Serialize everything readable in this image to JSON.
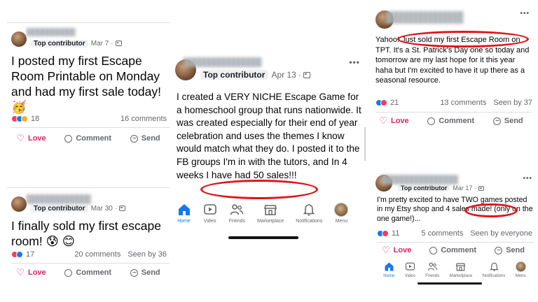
{
  "posts": [
    {
      "badge": "Top contributor",
      "date": "Mar 7",
      "text": "I posted my first Escape Room Printable on Monday and had my first sale today! 🥳",
      "reaction_count": "18",
      "comments": "16 comments",
      "actions": {
        "love": "Love",
        "comment": "Comment",
        "send": "Send"
      }
    },
    {
      "badge": "Top contributor",
      "date": "Mar 30",
      "text": "I finally sold my first escape room! 😰 😊",
      "reaction_count": "17",
      "comments": "20 comments",
      "seen": "Seen by 36",
      "actions": {
        "love": "Love",
        "comment": "Comment",
        "send": "Send"
      }
    },
    {
      "badge": "Top contributor",
      "date": "Apr 13",
      "text": "I created a VERY NICHE Escape Game for a homeschool group that runs nationwide. It was created especially for their end of year celebration and uses the themes I know would match what they do. I posted it to the FB groups I'm in with the tutors, and In 4 weeks I have had 50 sales!!!"
    },
    {
      "text": "Yahoo! Just sold my first Escape Room on TPT. It's a St. Patrick's Day one so today and tomorrow are my last hope for it this year haha but I'm excited to have it up there as a seasonal resource.",
      "reaction_count": "21",
      "comments": "13 comments",
      "seen": "Seen by 37",
      "actions": {
        "love": "Love",
        "comment": "Comment",
        "send": "Send"
      }
    },
    {
      "badge": "Top contributor",
      "date": "Mar 17",
      "text": "I'm pretty excited to have TWO games posted in my Etsy shop and 4 sales made! (only on the one game!)...",
      "reaction_count": "11",
      "comments": "5 comments",
      "seen": "Seen by everyone",
      "actions": {
        "love": "Love",
        "comment": "Comment",
        "send": "Send"
      }
    }
  ],
  "tabbar": {
    "home": "Home",
    "video": "Video",
    "friends": "Friends",
    "marketplace": "Marketplace",
    "notifications": "Notifications",
    "menu": "Menu"
  },
  "icons": {
    "more": "•••",
    "love_heart": "♡"
  },
  "colors": {
    "accent": "#1877f2",
    "love": "#e0245e",
    "highlight": "#e0141b",
    "muted": "#65676b"
  }
}
